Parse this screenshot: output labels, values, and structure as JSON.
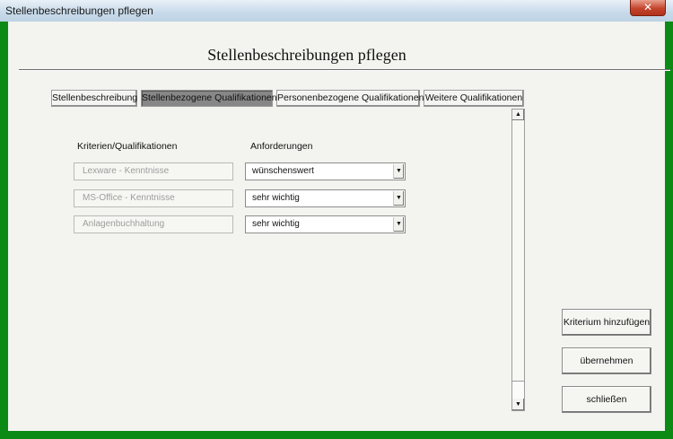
{
  "window": {
    "title": "Stellenbeschreibungen pflegen",
    "close_label": "✕"
  },
  "heading": "Stellenbeschreibungen pflegen",
  "tabs": [
    {
      "label": "Stellenbeschreibung"
    },
    {
      "label": "Stellenbezogene Qualifikationen"
    },
    {
      "label": "Personenbezogene Qualifikationen"
    },
    {
      "label": "Weitere Qualifikationen"
    }
  ],
  "columns": {
    "criteria": "Kriterien/Qualifikationen",
    "requirements": "Anforderungen"
  },
  "rows": [
    {
      "criterion": "Lexware - Kenntnisse",
      "requirement": "wünschenswert"
    },
    {
      "criterion": "MS-Office - Kenntnisse",
      "requirement": "sehr wichtig"
    },
    {
      "criterion": "Anlagenbuchhaltung",
      "requirement": "sehr wichtig"
    }
  ],
  "buttons": {
    "add_criterion": "Kriterium hinzufügen",
    "apply": "übernehmen",
    "close": "schließen"
  },
  "icons": {
    "dropdown": "▼",
    "scroll_up": "▲",
    "scroll_down": "▼"
  }
}
